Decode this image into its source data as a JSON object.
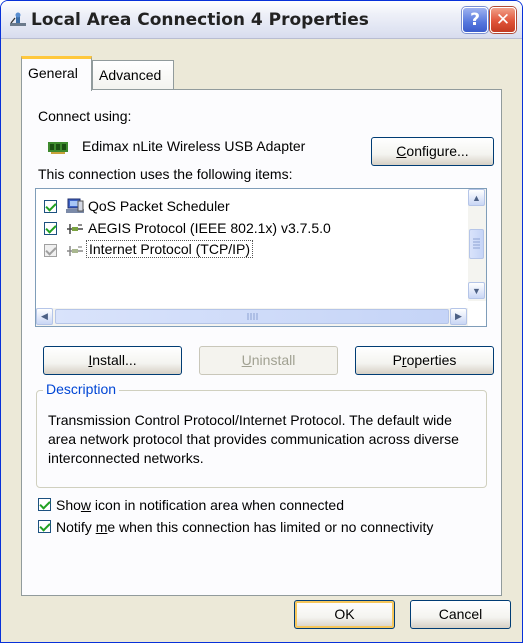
{
  "window": {
    "title": "Local Area Connection 4 Properties",
    "help_button": "?",
    "close_button": "✕"
  },
  "tabs": [
    {
      "label": "General",
      "active": true
    },
    {
      "label": "Advanced",
      "active": false
    }
  ],
  "connect_using": {
    "label": "Connect using:",
    "adapter_name": "Edimax nLite Wireless USB Adapter",
    "configure_button": {
      "before": "",
      "ul": "C",
      "after": "onfigure..."
    }
  },
  "items_section": {
    "label": "This connection uses the following items:",
    "items": [
      {
        "label": "QoS Packet Scheduler",
        "checked": true,
        "icon": "scheduler-icon"
      },
      {
        "label": "AEGIS Protocol (IEEE 802.1x) v3.7.5.0",
        "checked": true,
        "icon": "network-protocol-icon"
      },
      {
        "label": "Internet Protocol (TCP/IP)",
        "checked": true,
        "icon": "network-protocol-icon",
        "selected": true
      }
    ]
  },
  "buttons": {
    "install": {
      "before": "",
      "ul": "I",
      "after": "nstall..."
    },
    "uninstall": {
      "before": "",
      "ul": "U",
      "after": "ninstall"
    },
    "properties": {
      "before": "P",
      "ul": "r",
      "after": "operties"
    }
  },
  "description": {
    "legend": "Description",
    "text": "Transmission Control Protocol/Internet Protocol. The default wide area network protocol that provides communication across diverse interconnected networks."
  },
  "options": [
    {
      "before": "Sho",
      "ul": "w",
      "after": " icon in notification area when connected",
      "checked": true
    },
    {
      "before": "Notify ",
      "ul": "m",
      "after": "e when this connection has limited or no connectivity",
      "checked": true
    }
  ],
  "footer": {
    "ok": "OK",
    "cancel": "Cancel"
  },
  "colors": {
    "titlebar_border": "#0831d9",
    "dialog_bg": "#ece9d8",
    "focus_ring": "#f6c75c",
    "legend_text": "#0046d5",
    "checkmark": "#21a121"
  }
}
